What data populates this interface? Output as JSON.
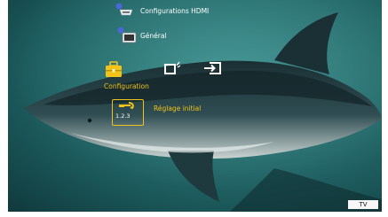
{
  "menu": {
    "hdmi_settings_label": "Configurations HDMI",
    "general_label": "Général",
    "category_label": "Configuration",
    "initial_setup_label": "Réglage initial",
    "initial_setup_icon_text": "1.2.3"
  },
  "status": {
    "badge": "TV"
  },
  "icons": {
    "hdmi_settings": "hdmi-port-icon",
    "general": "tv-screen-icon",
    "configuration": "toolbox-icon",
    "external": "tv-signal-icon",
    "input": "input-source-icon",
    "initial_setup": "wrench-icon"
  },
  "colors": {
    "accent": "#f2c318",
    "text": "#ffffff",
    "background": "#1c5a5c"
  }
}
